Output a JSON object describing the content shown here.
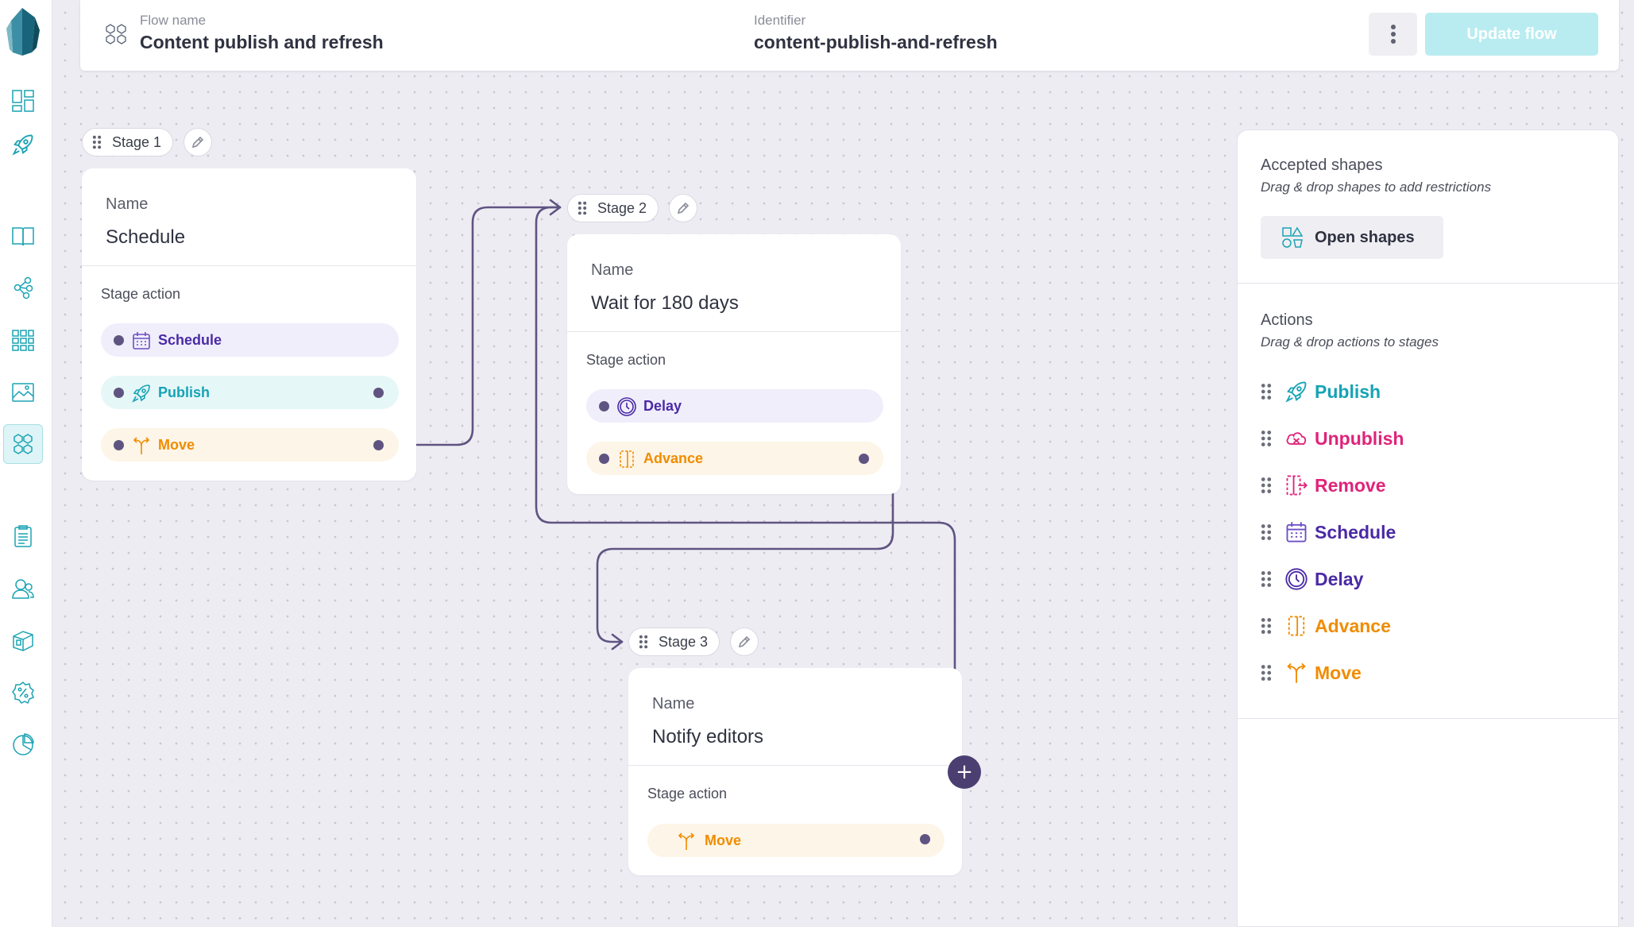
{
  "header": {
    "flow_name_label": "Flow name",
    "flow_name": "Content publish and refresh",
    "identifier_label": "Identifier",
    "identifier": "content-publish-and-refresh",
    "update_label": "Update flow"
  },
  "sidebar": {
    "items": [
      "dashboard-icon",
      "rocket-icon",
      "book-icon",
      "graph-icon",
      "grid-icon",
      "image-icon",
      "flows-icon",
      "clipboard-icon",
      "users-icon",
      "cube-icon",
      "percent-icon",
      "chart-icon"
    ],
    "active": "flows-icon"
  },
  "common": {
    "name_label": "Name",
    "stage_action_label": "Stage action"
  },
  "stages": [
    {
      "chip": "Stage 1",
      "name": "Schedule",
      "actions": [
        "Schedule",
        "Publish",
        "Move"
      ]
    },
    {
      "chip": "Stage 2",
      "name": "Wait for 180 days",
      "actions": [
        "Delay",
        "Advance"
      ]
    },
    {
      "chip": "Stage 3",
      "name": "Notify editors",
      "actions": [
        "Move"
      ]
    }
  ],
  "panel": {
    "accepted_title": "Accepted shapes",
    "accepted_sub": "Drag & drop shapes to add restrictions",
    "open_shapes": "Open shapes",
    "actions_title": "Actions",
    "actions_sub": "Drag & drop actions to stages",
    "actions": [
      {
        "label": "Publish",
        "color": "#16a3b5",
        "icon": "rocket-icon"
      },
      {
        "label": "Unpublish",
        "color": "#e0237a",
        "icon": "cloud-icon"
      },
      {
        "label": "Remove",
        "color": "#e0237a",
        "icon": "remove-icon"
      },
      {
        "label": "Schedule",
        "color": "#4a2aa5",
        "icon": "calendar-icon"
      },
      {
        "label": "Delay",
        "color": "#4a2aa5",
        "icon": "clock-icon"
      },
      {
        "label": "Advance",
        "color": "#f08c00",
        "icon": "advance-icon"
      },
      {
        "label": "Move",
        "color": "#f08c00",
        "icon": "move-icon"
      }
    ]
  },
  "colors": {
    "connector": "#5f5481",
    "purple": "#4a2aa5",
    "teal": "#16a3b5",
    "orange": "#f08c00",
    "pink": "#e0237a"
  }
}
